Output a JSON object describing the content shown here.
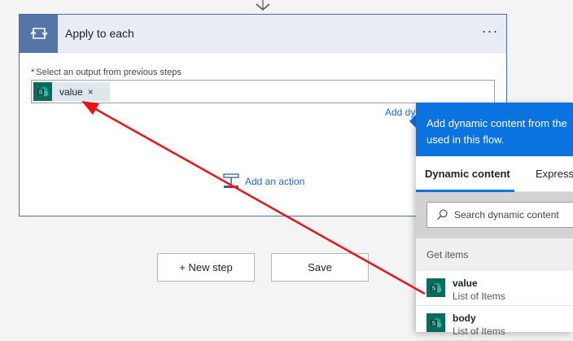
{
  "card": {
    "title": "Apply to each",
    "more_label": "···",
    "field_required_mark": "*",
    "field_label": "Select an output from previous steps",
    "token_label": "value",
    "token_remove": "×",
    "add_dynamic_link": "Add dynamic content",
    "add_action_label": "Add an action"
  },
  "footer": {
    "new_step_label": "+ New step",
    "save_label": "Save"
  },
  "panel": {
    "header_line1": "Add dynamic content from the",
    "header_line2": "used in this flow.",
    "tabs": [
      "Dynamic content",
      "Expression"
    ],
    "search_placeholder": "Search dynamic content",
    "section_title": "Get items",
    "items": [
      {
        "name": "value",
        "desc": "List of Items"
      },
      {
        "name": "body",
        "desc": "List of Items"
      }
    ]
  },
  "icons": {
    "loop": "loop-icon",
    "sharepoint": "sharepoint-icon",
    "search": "search-icon",
    "add_action": "add-action-icon",
    "connector": "chevron-down-icon"
  },
  "colors": {
    "accent_blue": "#0b73e0",
    "header_tile": "#5575a8",
    "sharepoint_teal": "#0b6a5e",
    "link_blue": "#2467c9",
    "annotation_red": "#e8141a"
  }
}
